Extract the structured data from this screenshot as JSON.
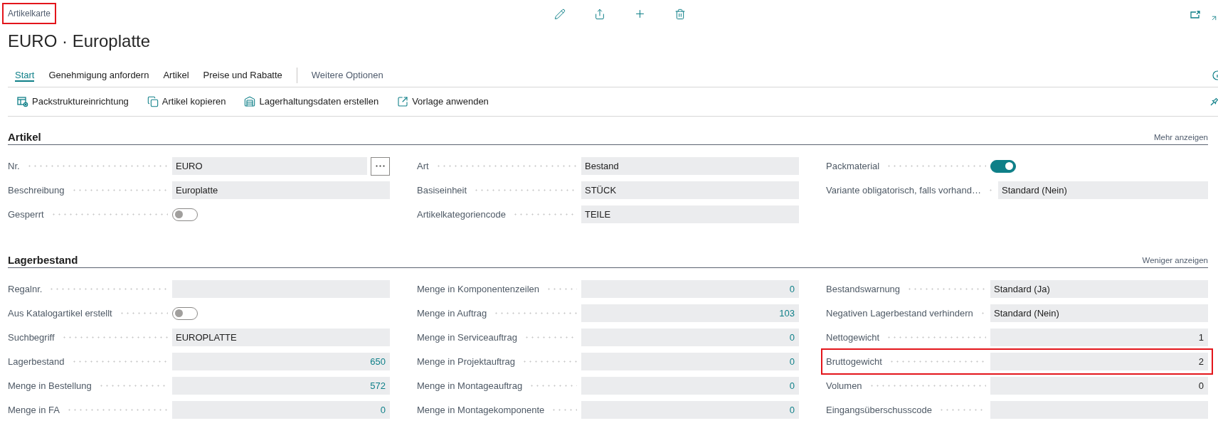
{
  "caption": {
    "text": "Artikelkarte",
    "highlighted": true
  },
  "title": "EURO · Europlatte",
  "tabs": [
    {
      "label": "Start",
      "selected": true
    },
    {
      "label": "Genehmigung anfordern",
      "selected": false
    },
    {
      "label": "Artikel",
      "selected": false
    },
    {
      "label": "Preise und Rabatte",
      "selected": false
    }
  ],
  "more_options": "Weitere Optionen",
  "actions": [
    {
      "label": "Packstruktureinrichtung"
    },
    {
      "label": "Artikel kopieren"
    },
    {
      "label": "Lagerhaltungsdaten erstellen"
    },
    {
      "label": "Vorlage anwenden"
    }
  ],
  "sections": [
    {
      "title": "Artikel",
      "link": "Mehr anzeigen",
      "columns": [
        {
          "fields": [
            {
              "label": "Nr.",
              "kind": "lookup",
              "value": "EURO",
              "highlighted": false
            },
            {
              "label": "Beschreibung",
              "kind": "text",
              "value": "Europlatte",
              "highlighted": false
            },
            {
              "label": "Gesperrt",
              "kind": "toggle",
              "on": false,
              "highlighted": false
            }
          ]
        },
        {
          "fields": [
            {
              "label": "Art",
              "kind": "text",
              "value": "Bestand",
              "highlighted": false
            },
            {
              "label": "Basiseinheit",
              "kind": "text",
              "value": "STÜCK",
              "highlighted": false
            },
            {
              "label": "Artikelkategoriencode",
              "kind": "text",
              "value": "TEILE",
              "highlighted": false
            }
          ]
        },
        {
          "fields": [
            {
              "label": "Packmaterial",
              "kind": "toggle",
              "on": true,
              "highlighted": false
            },
            {
              "label": "Variante obligatorisch, falls vorhand…",
              "kind": "text",
              "value": "Standard (Nein)",
              "highlighted": false
            }
          ]
        }
      ]
    },
    {
      "title": "Lagerbestand",
      "link": "Weniger anzeigen",
      "columns": [
        {
          "fields": [
            {
              "label": "Regalnr.",
              "kind": "text",
              "highlighted": false
            },
            {
              "label": "Aus Katalogartikel erstellt",
              "kind": "toggle",
              "on": false,
              "highlighted": false
            },
            {
              "label": "Suchbegriff",
              "kind": "text",
              "value": "EUROPLATTE",
              "highlighted": false
            },
            {
              "label": "Lagerbestand",
              "kind": "drilldown",
              "value": "650",
              "highlighted": false
            },
            {
              "label": "Menge in Bestellung",
              "kind": "drilldown",
              "value": "572",
              "highlighted": false
            },
            {
              "label": "Menge in FA",
              "kind": "drilldown",
              "value": "0",
              "highlighted": false
            }
          ]
        },
        {
          "fields": [
            {
              "label": "Menge in Komponentenzeilen",
              "kind": "drilldown",
              "value": "0",
              "highlighted": false
            },
            {
              "label": "Menge in Auftrag",
              "kind": "drilldown",
              "value": "103",
              "highlighted": false
            },
            {
              "label": "Menge in Serviceauftrag",
              "kind": "drilldown",
              "value": "0",
              "highlighted": false
            },
            {
              "label": "Menge in Projektauftrag",
              "kind": "drilldown",
              "value": "0",
              "highlighted": false
            },
            {
              "label": "Menge in Montageauftrag",
              "kind": "drilldown",
              "value": "0",
              "highlighted": false
            },
            {
              "label": "Menge in Montagekomponente",
              "kind": "drilldown",
              "value": "0",
              "highlighted": false
            }
          ]
        },
        {
          "fields": [
            {
              "label": "Bestandswarnung",
              "kind": "text",
              "value": "Standard (Ja)",
              "highlighted": false
            },
            {
              "label": "Negativen Lagerbestand verhindern",
              "kind": "text",
              "value": "Standard (Nein)",
              "highlighted": false
            },
            {
              "label": "Nettogewicht",
              "kind": "number",
              "value": "1",
              "highlighted": false
            },
            {
              "label": "Bruttogewicht",
              "kind": "number",
              "value": "2",
              "highlighted": true
            },
            {
              "label": "Volumen",
              "kind": "number",
              "value": "0",
              "highlighted": false
            },
            {
              "label": "Eingangsüberschusscode",
              "kind": "text",
              "highlighted": false
            }
          ]
        }
      ]
    }
  ]
}
